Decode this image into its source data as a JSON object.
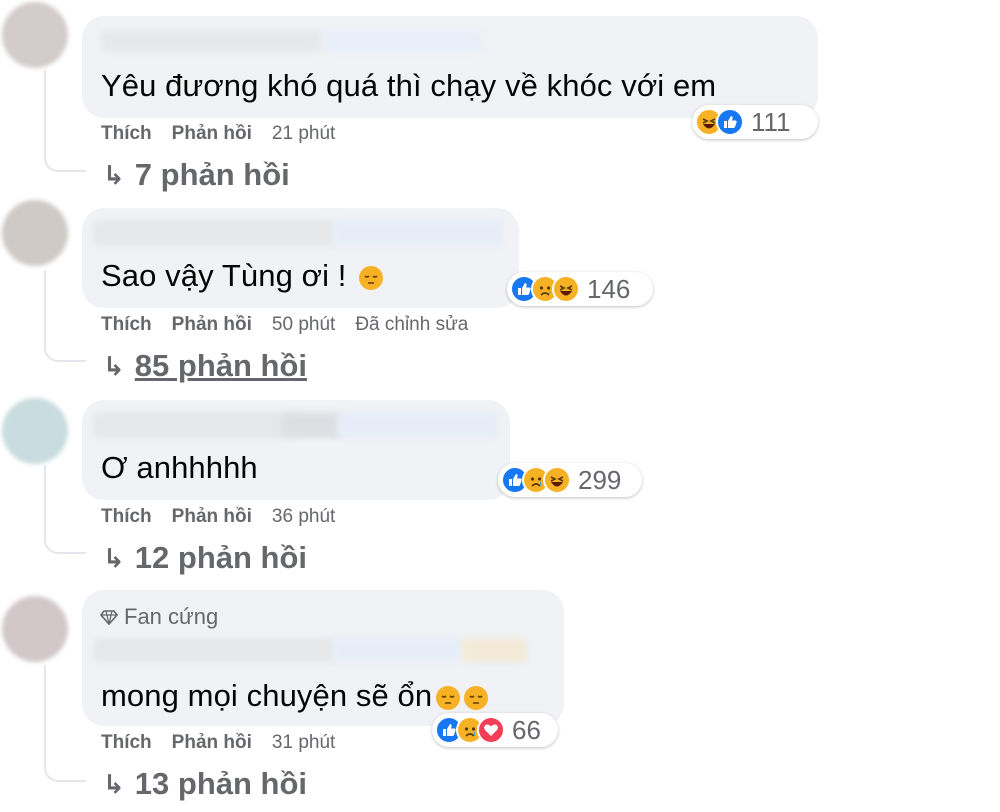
{
  "comments": [
    {
      "text": "Yêu đương khó quá thì chạy về khóc với em",
      "reaction_count": "111",
      "reactions": [
        "haha-icon",
        "like-icon"
      ],
      "like": "Thích",
      "reply": "Phản hồi",
      "time": "21 phút",
      "replies": "7 phản hồi"
    },
    {
      "text": "Sao vậy Tùng ơi !",
      "reaction_count": "146",
      "reactions": [
        "like-icon",
        "sad-icon",
        "haha-icon"
      ],
      "like": "Thích",
      "reply": "Phản hồi",
      "time": "50 phút",
      "edited": "Đã chỉnh sửa",
      "replies": "85 phản hồi"
    },
    {
      "text": "Ơ anhhhhh",
      "reaction_count": "299",
      "reactions": [
        "like-icon",
        "sad-icon",
        "haha-icon"
      ],
      "like": "Thích",
      "reply": "Phản hồi",
      "time": "36 phút",
      "replies": "12 phản hồi"
    },
    {
      "badge": "Fan cứng",
      "text": "mong mọi chuyện sẽ ổn",
      "reaction_count": "66",
      "reactions": [
        "like-icon",
        "sad-icon",
        "love-icon"
      ],
      "like": "Thích",
      "reply": "Phản hồi",
      "time": "31 phút",
      "replies": "13 phản hồi"
    }
  ],
  "colors": {
    "bubble": "#f0f2f5",
    "secondary_text": "#65676b",
    "like_blue": "#1877f2",
    "emoji_yellow": "#f7b125",
    "love_red": "#f33e58"
  }
}
